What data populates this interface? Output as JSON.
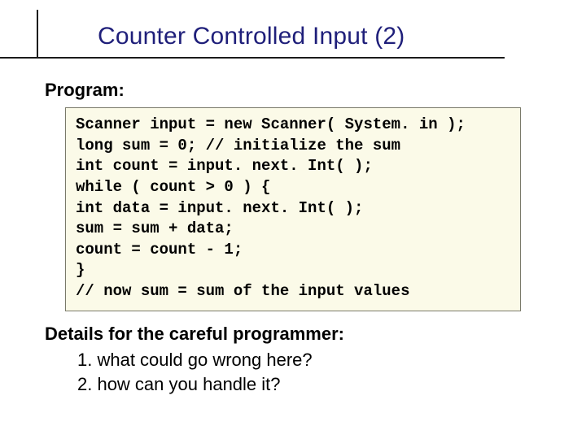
{
  "title": "Counter Controlled Input (2)",
  "program_label": "Program:",
  "code": "Scanner input = new Scanner( System. in );\nlong sum = 0; // initialize the sum\nint count = input. next. Int( );\nwhile ( count > 0 ) {\nint data = input. next. Int( );\nsum = sum + data;\ncount = count - 1;\n}\n// now sum = sum of the input values",
  "details_label": "Details for the careful programmer:",
  "details": {
    "item1": "1. what could go wrong here?",
    "item2": "2. how can you handle it?"
  }
}
